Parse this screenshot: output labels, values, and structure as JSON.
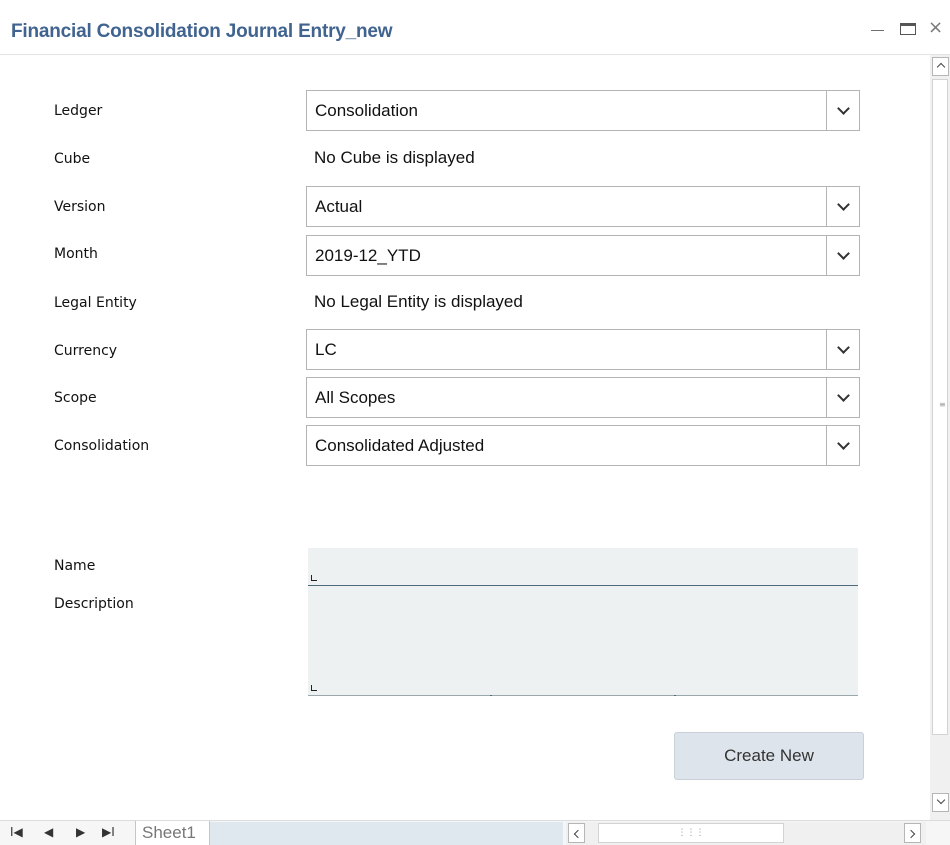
{
  "window": {
    "title": "Financial Consolidation Journal Entry_new",
    "minimize_icon": "minimize-icon",
    "maximize_icon": "maximize-icon",
    "close_icon": "close-icon",
    "close_glyph": "×"
  },
  "form": {
    "ledger": {
      "label": "Ledger",
      "value": "Consolidation"
    },
    "cube": {
      "label": "Cube",
      "value": "No Cube is displayed"
    },
    "version": {
      "label": "Version",
      "value": "Actual"
    },
    "month": {
      "label": "Month",
      "value": "2019-12_YTD"
    },
    "legal_entity": {
      "label": "Legal Entity",
      "value": "No Legal Entity is displayed"
    },
    "currency": {
      "label": "Currency",
      "value": "LC"
    },
    "scope": {
      "label": "Scope",
      "value": "All Scopes"
    },
    "consolidation": {
      "label": "Consolidation",
      "value": "Consolidated Adjusted"
    },
    "name": {
      "label": "Name",
      "value": ""
    },
    "description": {
      "label": "Description",
      "value": ""
    }
  },
  "actions": {
    "create_new": "Create New"
  },
  "sheet_tabs": {
    "first_icon": "first-sheet-icon",
    "prev_icon": "prev-sheet-icon",
    "next_icon": "next-sheet-icon",
    "last_icon": "last-sheet-icon",
    "first_glyph": "I◀",
    "prev_glyph": "◀",
    "next_glyph": "▶",
    "last_glyph": "▶I",
    "active": "Sheet1"
  },
  "colors": {
    "title": "#40638f",
    "button_bg": "#dde4ec",
    "textbox_bg": "#eef1f1"
  }
}
